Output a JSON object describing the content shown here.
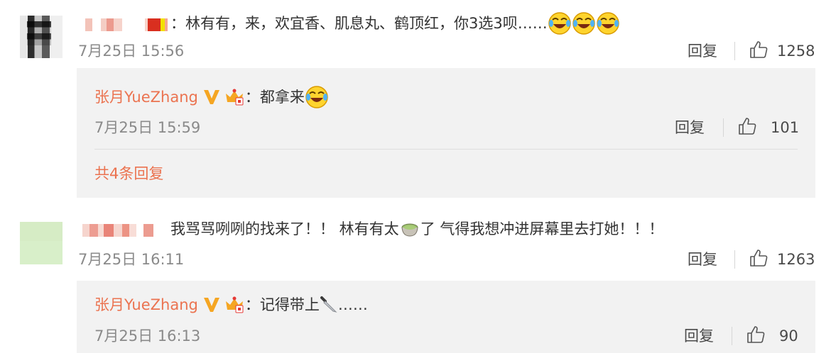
{
  "comments": [
    {
      "content": "：林有有，来，欢宜香、肌息丸、鹤顶红，你3选3呗……",
      "timestamp": "7月25日 15:56",
      "reply_label": "回复",
      "likes": "1258",
      "emoji_icon": "laughing-crying-emoji",
      "replies": [
        {
          "author": "张月YueZhang",
          "content": "：都拿来",
          "timestamp": "7月25日 15:59",
          "reply_label": "回复",
          "likes": "101"
        }
      ],
      "more_replies_label": "共4条回复"
    },
    {
      "content": "我骂骂咧咧的找来了！！ 林有有太",
      "content_suffix": "了 气得我想冲进屏幕里去打她！！！",
      "timestamp": "7月25日 16:11",
      "reply_label": "回复",
      "likes": "1263",
      "replies": [
        {
          "author": "张月YueZhang",
          "content": "：记得带上",
          "content_suffix": "……",
          "timestamp": "7月25日 16:13",
          "reply_label": "回复",
          "likes": "90"
        }
      ]
    }
  ],
  "colors": {
    "name_orange": "#eb7350",
    "verified_gold": "#f5a623",
    "reply_bg": "#f2f2f2",
    "meta_gray": "#8a8a8a"
  },
  "icons": {
    "like": "thumbs-up-outline-icon",
    "verified": "verified-v-icon",
    "vip": "crown-vip-icon",
    "tea": "green-tea-emoji",
    "knife": "knife-emoji"
  }
}
